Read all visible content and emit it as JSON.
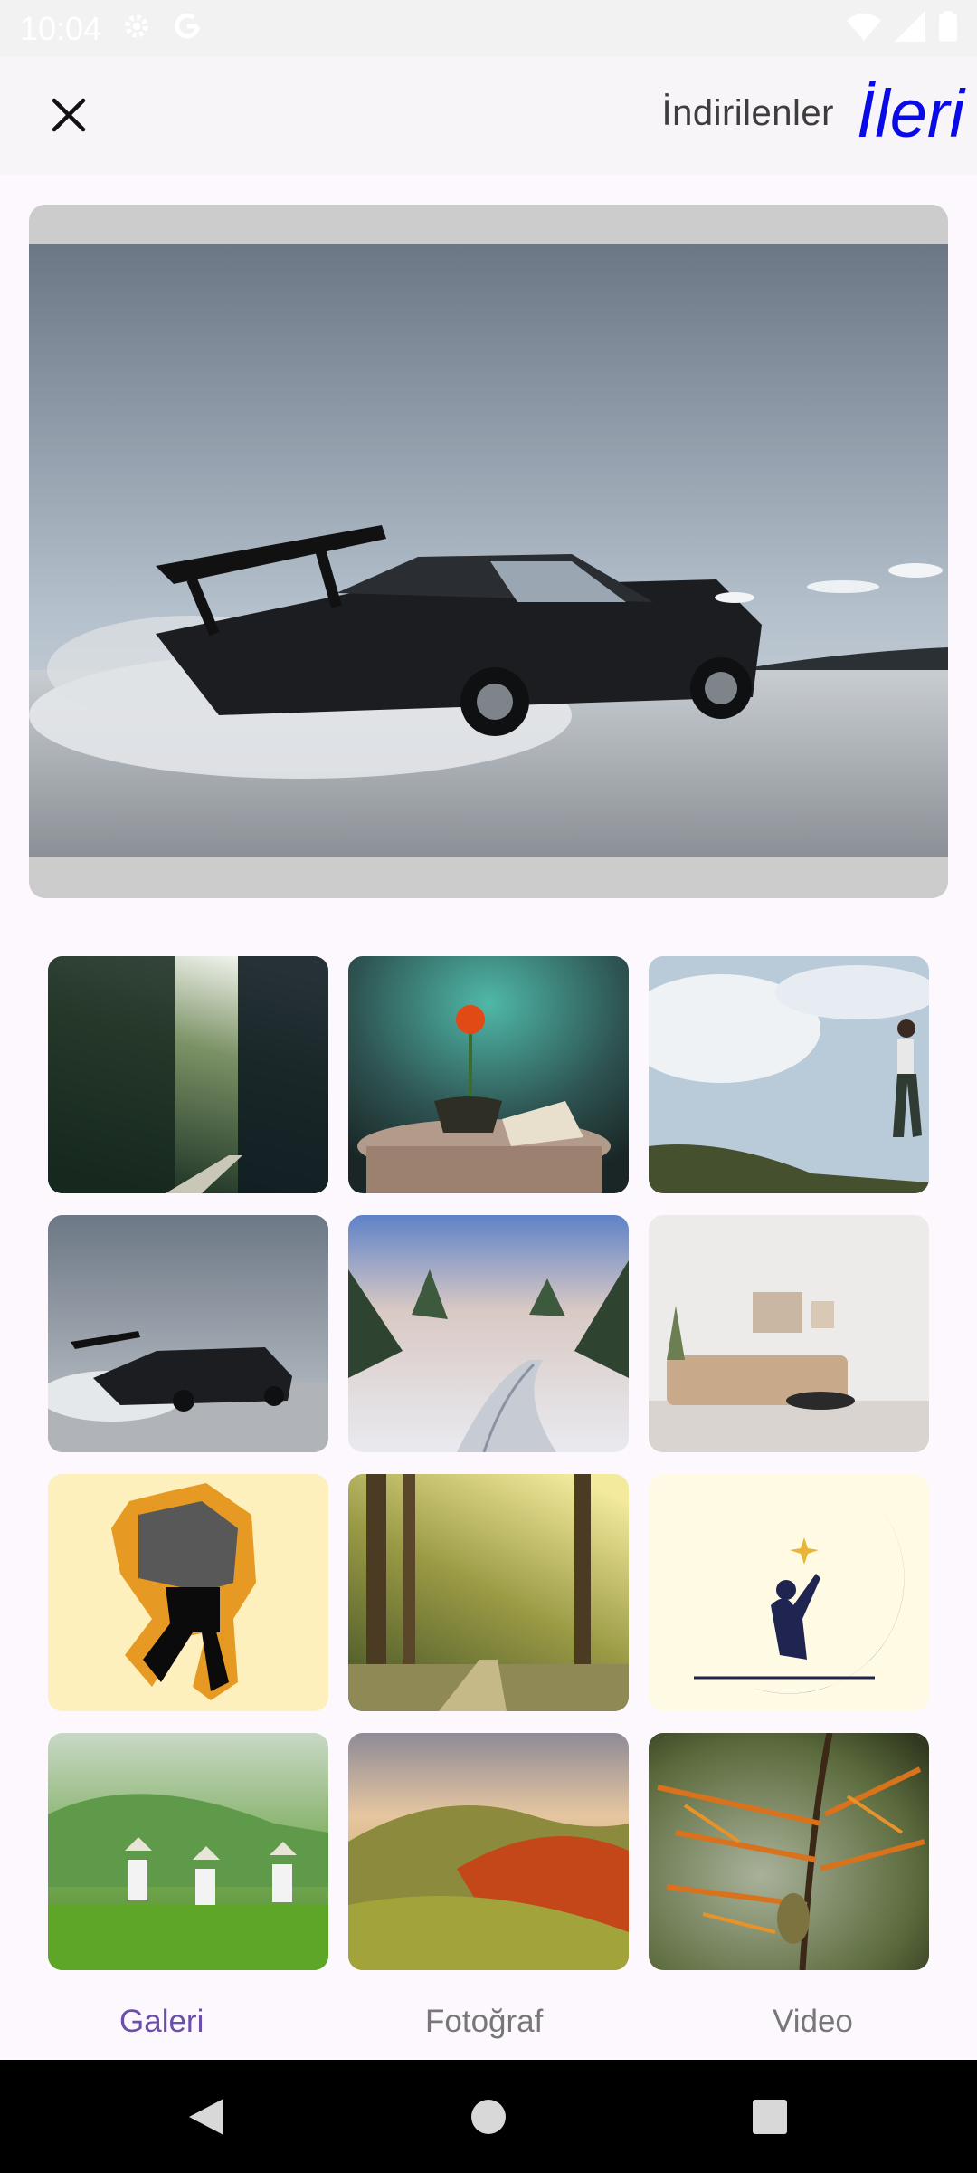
{
  "status_bar": {
    "time": "10:04",
    "icons": [
      "gear-icon",
      "google-icon",
      "wifi-icon",
      "signal-icon",
      "battery-icon"
    ]
  },
  "top_bar": {
    "close_icon": "close-icon",
    "downloads_label": "İndirilenler",
    "next_label": "İleri"
  },
  "preview": {
    "subject": "car drifting in snow"
  },
  "grid": {
    "tiles": [
      "forest road with sun rays",
      "red flower vase on table",
      "woman jumping on hill",
      "car drifting in snow",
      "snowy road with trees",
      "living room interior",
      "pixel art dancing figure",
      "forest path with light",
      "girl on crescent moon",
      "tea pickers on green hills",
      "autumn hills landscape",
      "pine branch close-up"
    ]
  },
  "tabs": {
    "gallery": "Galeri",
    "photo": "Fotoğraf",
    "video": "Video",
    "active": "gallery"
  },
  "colors": {
    "accent": "#0a0ae6",
    "tab_active": "#6b4fa8",
    "background": "#fdf7fe"
  }
}
